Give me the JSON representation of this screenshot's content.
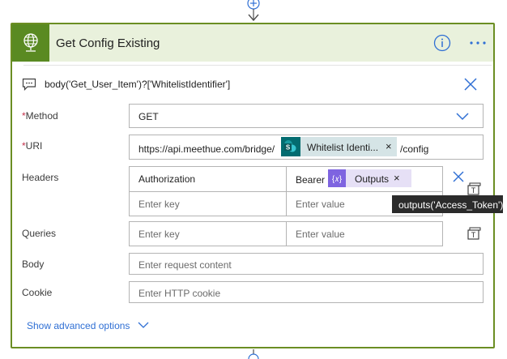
{
  "action": {
    "title": "Get Config Existing",
    "comment": "body('Get_User_Item')?['WhitelistIdentifier']"
  },
  "fields": {
    "method": {
      "label": "Method",
      "required": "*",
      "value": "GET"
    },
    "uri": {
      "label": "URI",
      "required": "*",
      "prefix": "https://api.meethue.com/bridge/",
      "token_label": "Whitelist Identi...",
      "token_remove": "×",
      "suffix": "/config"
    },
    "headers": {
      "label": "Headers",
      "row1_key": "Authorization",
      "row1_value_prefix": "Bearer",
      "row1_token": "Outputs",
      "row1_token_remove": "×",
      "key_placeholder": "Enter key",
      "value_placeholder": "Enter value"
    },
    "queries": {
      "label": "Queries",
      "key_placeholder": "Enter key",
      "value_placeholder": "Enter value"
    },
    "body": {
      "label": "Body",
      "placeholder": "Enter request content"
    },
    "cookie": {
      "label": "Cookie",
      "placeholder": "Enter HTTP cookie"
    }
  },
  "tooltip": "outputs('Access_Token')",
  "advanced": {
    "label": "Show advanced options"
  },
  "colors": {
    "card_border": "#6b8e23",
    "header_bg": "#e9f1dc",
    "header_icon_bg": "#5a8a22",
    "accent_blue": "#2f6fd4",
    "required_red": "#c4314b",
    "sharepoint_token": "#036c70",
    "expression_token": "#7e64e0"
  },
  "icons": {
    "header": "globe-icon",
    "comment": "comment-icon",
    "info": "info-icon",
    "more": "more-options-icon",
    "close": "close-icon",
    "dropdown": "chevron-down-icon",
    "sharepoint": "sharepoint-icon",
    "expression": "expression-icon",
    "text_mode": "switch-to-text-mode-icon"
  }
}
